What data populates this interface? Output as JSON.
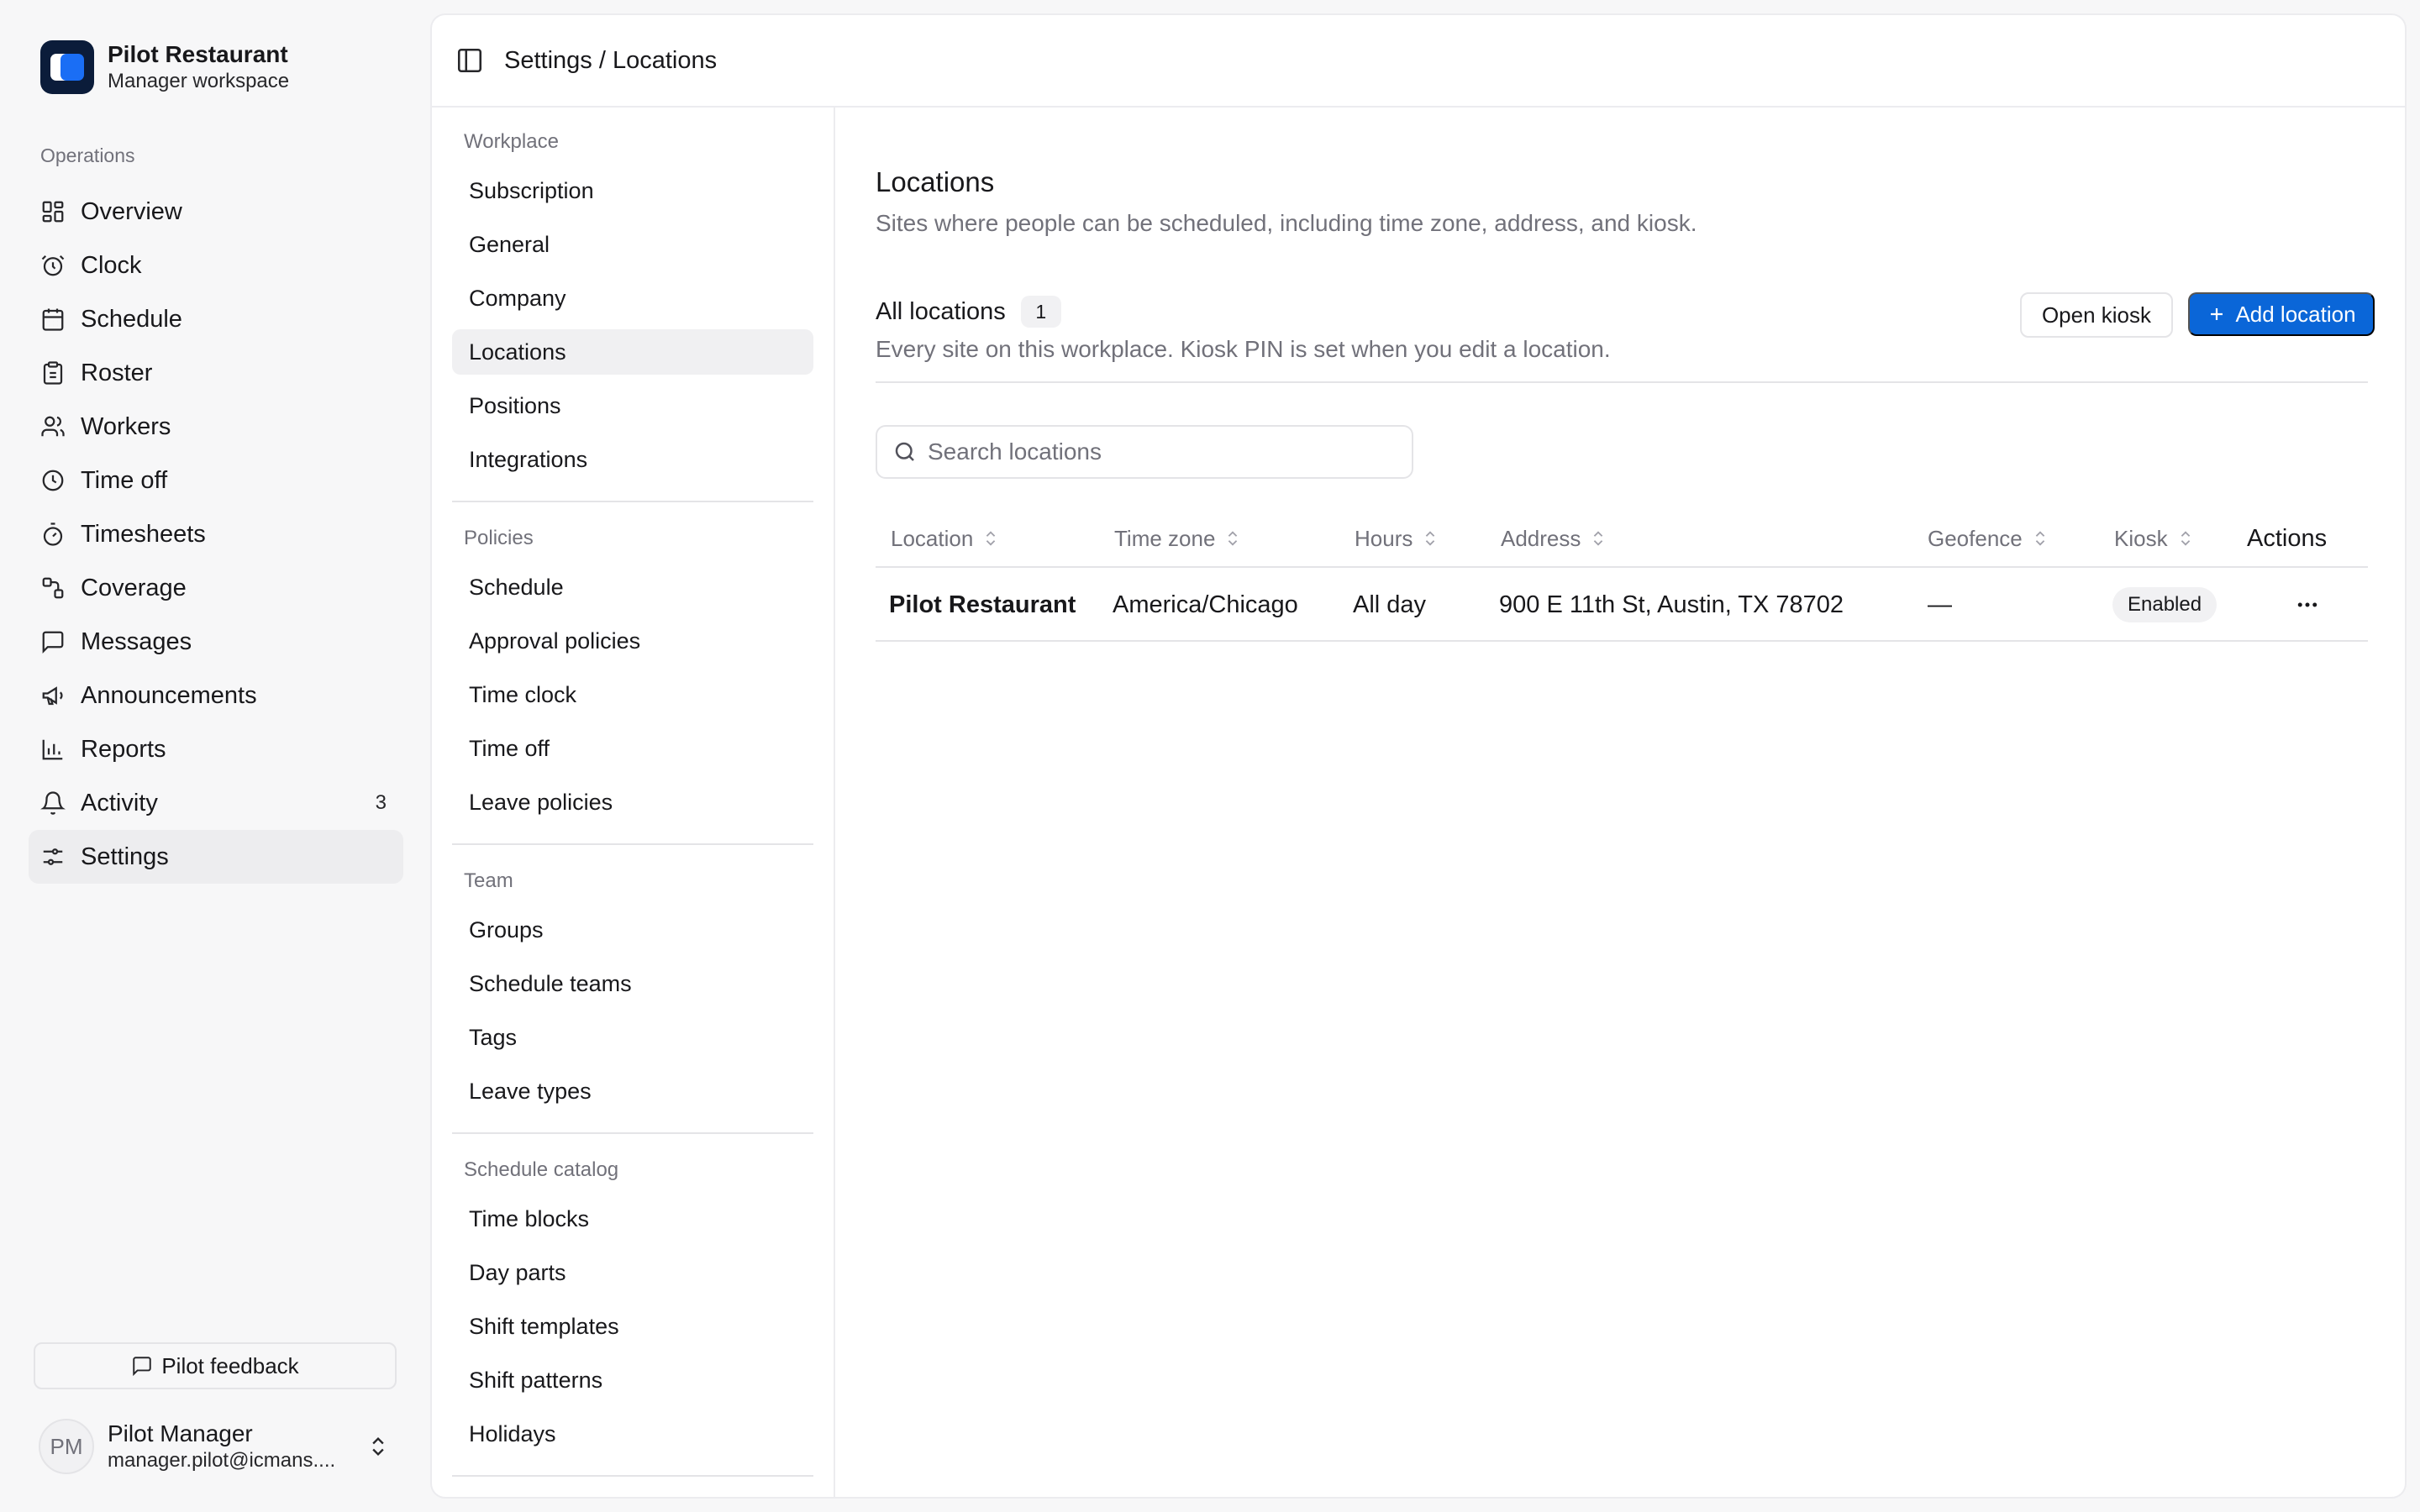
{
  "brand": {
    "name": "Pilot Restaurant",
    "subtitle": "Manager workspace"
  },
  "sidebar": {
    "section_label": "Operations",
    "items": [
      {
        "label": "Overview",
        "icon": "grid-icon"
      },
      {
        "label": "Clock",
        "icon": "alarm-clock-icon"
      },
      {
        "label": "Schedule",
        "icon": "calendar-icon"
      },
      {
        "label": "Roster",
        "icon": "clipboard-icon"
      },
      {
        "label": "Workers",
        "icon": "users-icon"
      },
      {
        "label": "Time off",
        "icon": "clock-icon"
      },
      {
        "label": "Timesheets",
        "icon": "timer-icon"
      },
      {
        "label": "Coverage",
        "icon": "route-icon"
      },
      {
        "label": "Messages",
        "icon": "message-icon"
      },
      {
        "label": "Announcements",
        "icon": "megaphone-icon"
      },
      {
        "label": "Reports",
        "icon": "bar-chart-icon"
      },
      {
        "label": "Activity",
        "icon": "bell-icon",
        "badge": "3"
      },
      {
        "label": "Settings",
        "icon": "sliders-icon",
        "active": true
      }
    ],
    "feedback_label": "Pilot feedback"
  },
  "user": {
    "initials": "PM",
    "name": "Pilot Manager",
    "email": "manager.pilot@icmans...."
  },
  "topbar": {
    "breadcrumb": "Settings / Locations"
  },
  "settings_nav": {
    "groups": [
      {
        "heading": "Workplace",
        "items": [
          "Subscription",
          "General",
          "Company",
          "Locations",
          "Positions",
          "Integrations"
        ]
      },
      {
        "heading": "Policies",
        "items": [
          "Schedule",
          "Approval policies",
          "Time clock",
          "Time off",
          "Leave policies"
        ]
      },
      {
        "heading": "Team",
        "items": [
          "Groups",
          "Schedule teams",
          "Tags",
          "Leave types"
        ]
      },
      {
        "heading": "Schedule catalog",
        "items": [
          "Time blocks",
          "Day parts",
          "Shift templates",
          "Shift patterns",
          "Holidays"
        ]
      }
    ],
    "active_item": "Locations"
  },
  "page": {
    "title": "Locations",
    "description": "Sites where people can be scheduled, including time zone, address, and kiosk."
  },
  "list": {
    "title": "All locations",
    "count": "1",
    "description": "Every site on this workplace. Kiosk PIN is set when you edit a location.",
    "open_kiosk_label": "Open kiosk",
    "add_location_label": "Add location"
  },
  "search": {
    "placeholder": "Search locations",
    "value": ""
  },
  "table": {
    "columns": [
      "Location",
      "Time zone",
      "Hours",
      "Address",
      "Geofence",
      "Kiosk",
      "Actions"
    ],
    "rows": [
      {
        "location": "Pilot Restaurant",
        "time_zone": "America/Chicago",
        "hours": "All day",
        "address": "900 E 11th St, Austin, TX 78702",
        "geofence": "—",
        "kiosk": "Enabled"
      }
    ]
  },
  "colors": {
    "accent": "#0a66d8",
    "brand_dark": "#0b1c3a",
    "brand_blue": "#1a6ef5",
    "muted_text": "#71717a"
  }
}
